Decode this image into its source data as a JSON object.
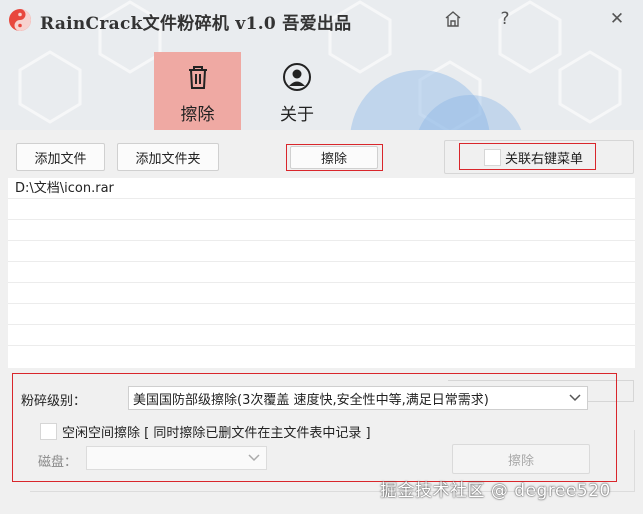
{
  "window": {
    "title": "RainCrack文件粉碎机 v1.0 吾爱出品",
    "home_icon": "home-icon",
    "help_label": "?",
    "close_label": "✕"
  },
  "tabs": [
    {
      "label": "擦除",
      "icon": "trash-icon",
      "active": true
    },
    {
      "label": "关于",
      "icon": "user-icon",
      "active": false
    }
  ],
  "toolbar": {
    "add_file_label": "添加文件",
    "add_folder_label": "添加文件夹",
    "erase_label": "擦除",
    "context_menu_label": "关联右键菜单"
  },
  "file_list": {
    "items": [
      "D:\\文档\\icon.rar"
    ]
  },
  "options": {
    "level_label": "粉碎级别：",
    "level_value": "美国国防部级擦除(3次覆盖 速度快,安全性中等,满足日常需求)",
    "free_space_label": "空闲空间擦除 [ 同时擦除已删文件在主文件表中记录 ]",
    "disk_label": "磁盘：",
    "disk_value": "",
    "disk_erase_label": "擦除"
  },
  "watermark": "掘金技术社区 @ degree520",
  "colors": {
    "accent_tab": "#efa9a3",
    "highlight_border": "#d9262b"
  }
}
